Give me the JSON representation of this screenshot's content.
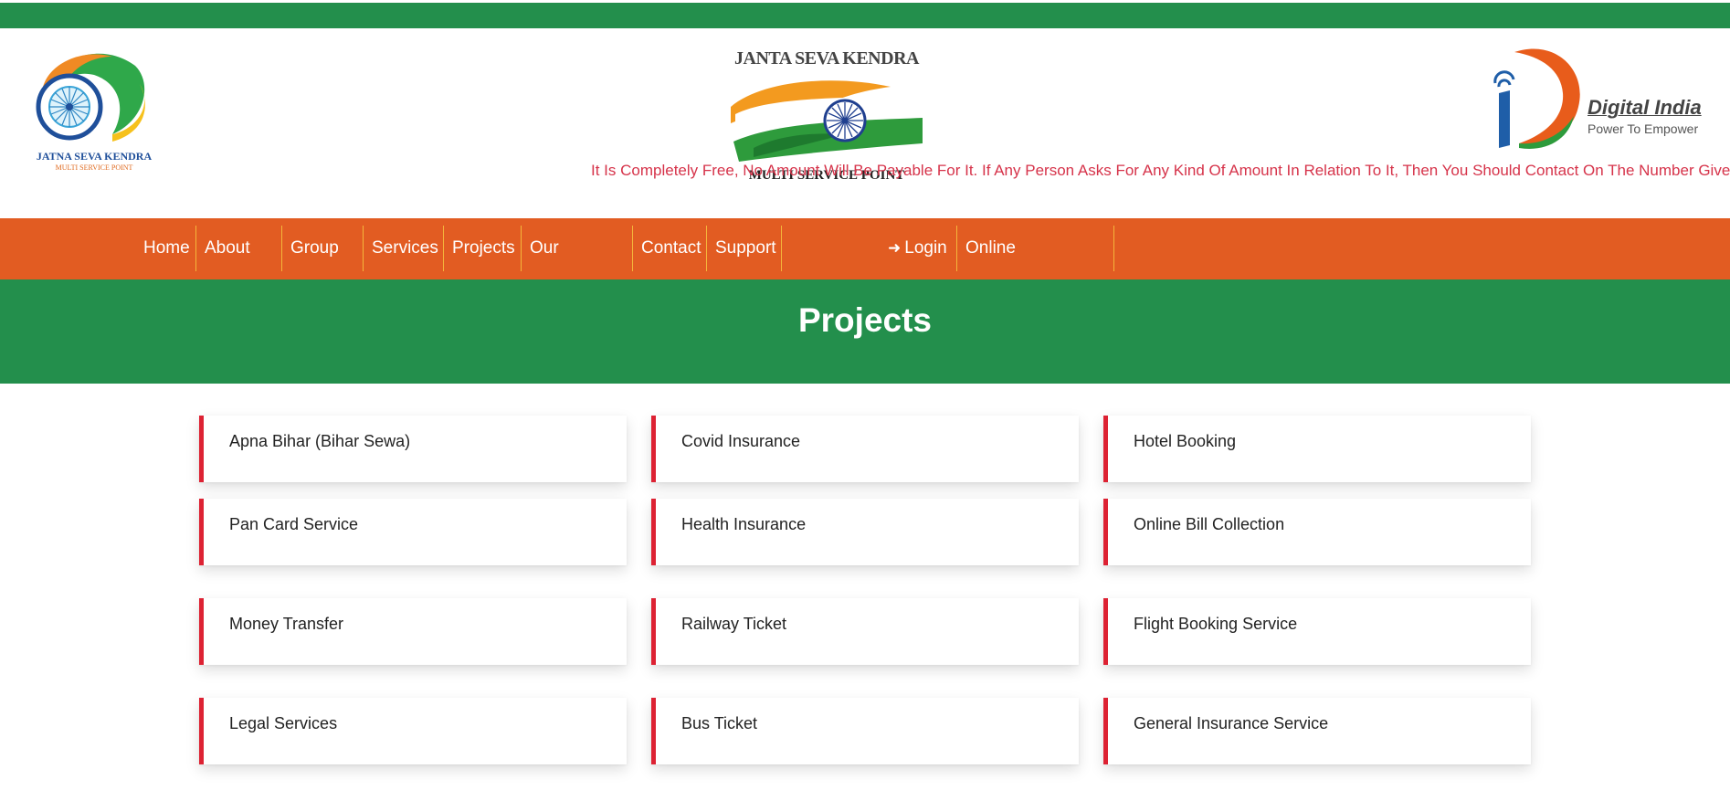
{
  "header": {
    "left_logo": {
      "name": "JATNA SEVA KENDRA",
      "sub": "MULTI SERVICE POINT"
    },
    "center_logo": {
      "title": "JANTA SEVA KENDRA",
      "sub": "MULTI SERVICE POINT"
    },
    "right_logo": {
      "title": "Digital India",
      "sub": "Power To Empower"
    },
    "notice": "It Is Completely Free, No Amount Will Be Payable For It. If Any Person Asks For Any Kind Of Amount In Relation To It, Then You Should Contact On The Number Given"
  },
  "nav": {
    "home": "Home",
    "about": "About Us",
    "group": "Group",
    "services": "Services",
    "projects": "Projects",
    "partners": "Our Partners",
    "contact": "Contact",
    "support": "Support",
    "login": "Login",
    "registration": "Online Registration"
  },
  "hero": {
    "title": "Projects"
  },
  "projects": [
    "Apna Bihar (Bihar Sewa)",
    "Covid Insurance",
    "Hotel Booking",
    "Pan Card Service",
    "Health Insurance",
    "Online Bill Collection",
    "Money Transfer",
    "Railway Ticket",
    "Flight Booking Service",
    "Legal Services",
    "Bus Ticket",
    "General Insurance Service"
  ],
  "colors": {
    "green": "#238f4c",
    "orange": "#e25c22",
    "accent_red": "#dd2233",
    "notice_red": "#d6334a"
  }
}
